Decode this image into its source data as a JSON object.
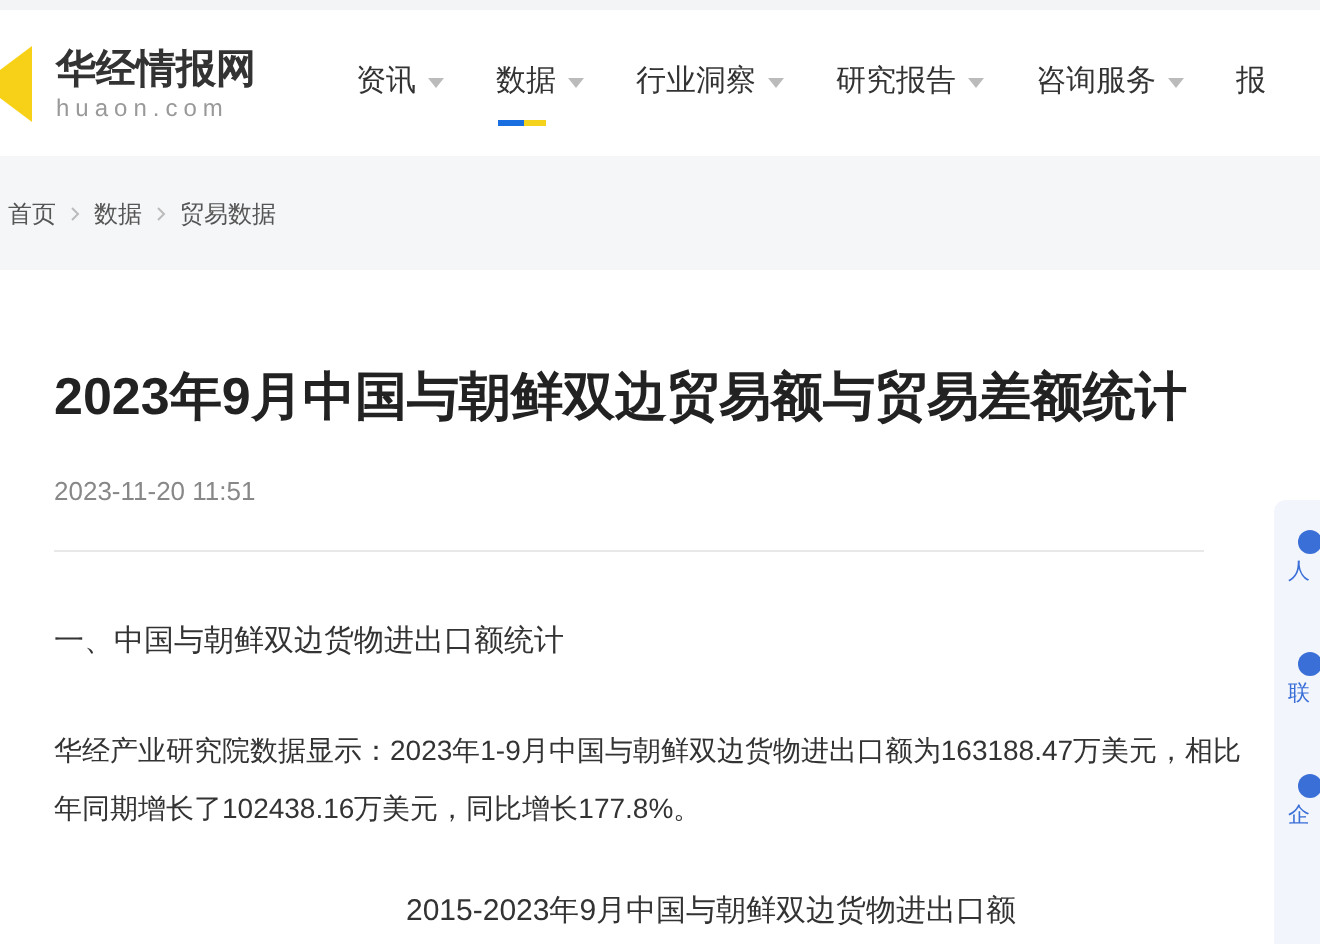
{
  "header": {
    "logo": {
      "name": "华经情报网",
      "domain": "huaon.com"
    },
    "nav": [
      {
        "label": "资讯",
        "selected": false,
        "caret": true
      },
      {
        "label": "数据",
        "selected": true,
        "caret": true
      },
      {
        "label": "行业洞察",
        "selected": false,
        "caret": true
      },
      {
        "label": "研究报告",
        "selected": false,
        "caret": true
      },
      {
        "label": "咨询服务",
        "selected": false,
        "caret": true
      },
      {
        "label": "报",
        "selected": false,
        "caret": false
      }
    ]
  },
  "breadcrumb": [
    "首页",
    "数据",
    "贸易数据"
  ],
  "article": {
    "title": "2023年9月中国与朝鲜双边贸易额与贸易差额统计",
    "date": "2023-11-20 11:51",
    "section_heading": "一、中国与朝鲜双边货物进出口额统计",
    "paragraph_lines": [
      "华经产业研究院数据显示：2023年1-9月中国与朝鲜双边货物进出口额为163188.47万美元，相比",
      "年同期增长了102438.16万美元，同比增长177.8%。"
    ],
    "caption": "2015-2023年9月中国与朝鲜双边货物进出口额"
  },
  "side_panel": [
    {
      "label": "人"
    },
    {
      "label": "联"
    },
    {
      "label": "企"
    }
  ]
}
